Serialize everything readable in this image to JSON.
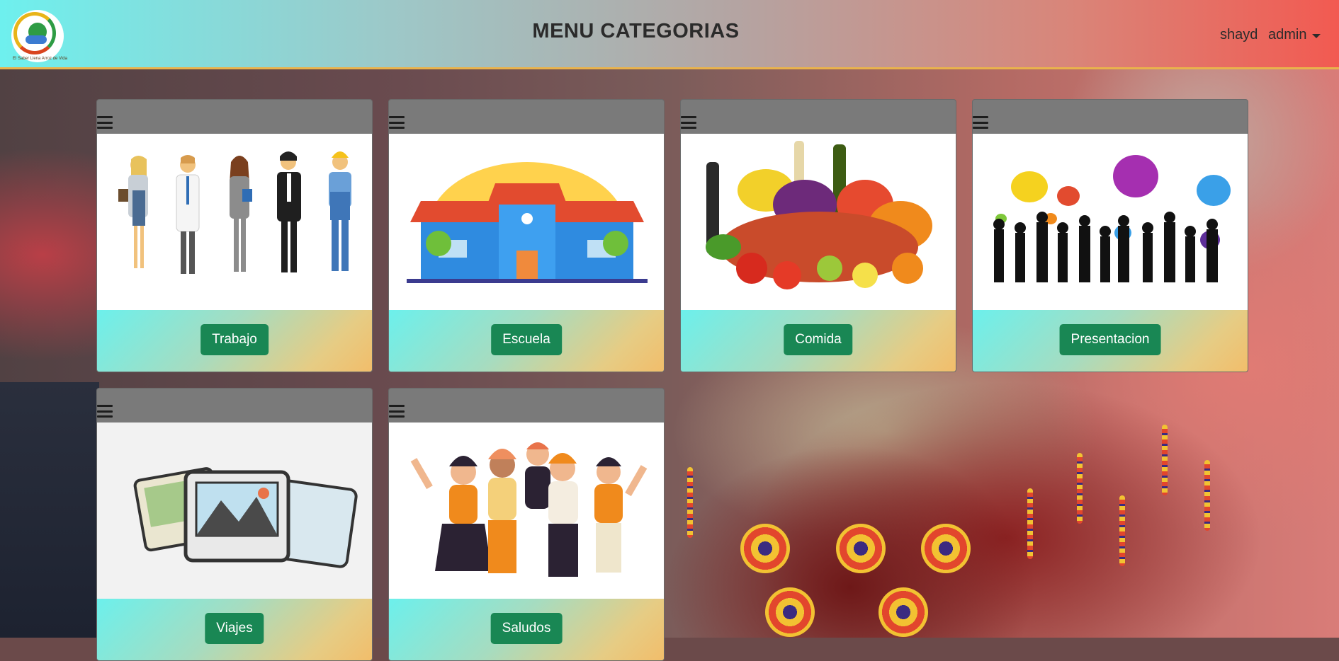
{
  "navbar": {
    "title": "MENU CATEGORIAS",
    "username": "shayd",
    "role_menu_label": "admin",
    "logo": {
      "icon": "school-logo-icon",
      "tagline": "El Saber Llena Arroz de Vida"
    },
    "colors": {
      "gradient_start": "#6ef0ee",
      "gradient_end": "#f25a51",
      "border": "#e9b24c"
    }
  },
  "categories": [
    {
      "label": "Trabajo",
      "image": "professionals-illustration"
    },
    {
      "label": "Escuela",
      "image": "school-building-illustration"
    },
    {
      "label": "Comida",
      "image": "food-groceries-photo"
    },
    {
      "label": "Presentacion",
      "image": "people-speech-bubbles-illustration"
    },
    {
      "label": "Viajes",
      "image": "travel-photos-illustration"
    },
    {
      "label": "Saludos",
      "image": "friends-waving-illustration"
    }
  ],
  "colors": {
    "button": "#198754",
    "card_header": "#7a7a7a"
  }
}
